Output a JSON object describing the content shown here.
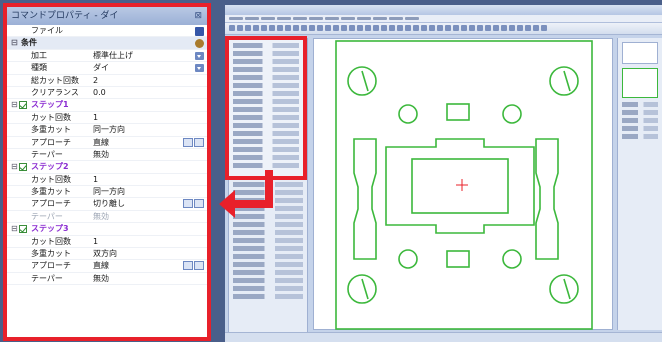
{
  "panel": {
    "title": "コマンドプロパティ - ダイ",
    "pin": "⊠"
  },
  "rows": [
    {
      "type": "item",
      "label": "ファイル",
      "value": "",
      "icon": "save-icon"
    },
    {
      "type": "section",
      "label": "条件",
      "value": "",
      "icon": "gear-icon"
    },
    {
      "type": "item",
      "label": "加工",
      "value": "標準仕上げ",
      "icon": "dropdown"
    },
    {
      "type": "item",
      "label": "種類",
      "value": "ダイ",
      "icon": "dropdown"
    },
    {
      "type": "item",
      "label": "総カット回数",
      "value": "2",
      "icon": ""
    },
    {
      "type": "item",
      "label": "クリアランス",
      "value": "0.0",
      "icon": ""
    },
    {
      "type": "step",
      "label": "ステップ1",
      "value": "",
      "icon": ""
    },
    {
      "type": "item",
      "label": "カット回数",
      "value": "1",
      "icon": ""
    },
    {
      "type": "item",
      "label": "多重カット",
      "value": "同一方向",
      "icon": ""
    },
    {
      "type": "item",
      "label": "アプローチ",
      "value": "直線",
      "icon": "buttons"
    },
    {
      "type": "item",
      "label": "テーパー",
      "value": "無効",
      "icon": ""
    },
    {
      "type": "step",
      "label": "ステップ2",
      "value": "",
      "icon": ""
    },
    {
      "type": "item",
      "label": "カット回数",
      "value": "1",
      "icon": ""
    },
    {
      "type": "item",
      "label": "多重カット",
      "value": "同一方向",
      "icon": ""
    },
    {
      "type": "item",
      "label": "アプローチ",
      "value": "切り離し",
      "icon": "buttons"
    },
    {
      "type": "disabled",
      "label": "テーパー",
      "value": "無効",
      "icon": ""
    },
    {
      "type": "step",
      "label": "ステップ3",
      "value": "",
      "icon": ""
    },
    {
      "type": "item",
      "label": "カット回数",
      "value": "1",
      "icon": ""
    },
    {
      "type": "item",
      "label": "多重カット",
      "value": "双方向",
      "icon": ""
    },
    {
      "type": "item",
      "label": "アプローチ",
      "value": "直線",
      "icon": "buttons"
    },
    {
      "type": "item",
      "label": "テーパー",
      "value": "無効",
      "icon": ""
    }
  ],
  "colors": {
    "highlight": "#e8202a",
    "drawing": "#3cb83c",
    "accent": "#6d88c2"
  }
}
